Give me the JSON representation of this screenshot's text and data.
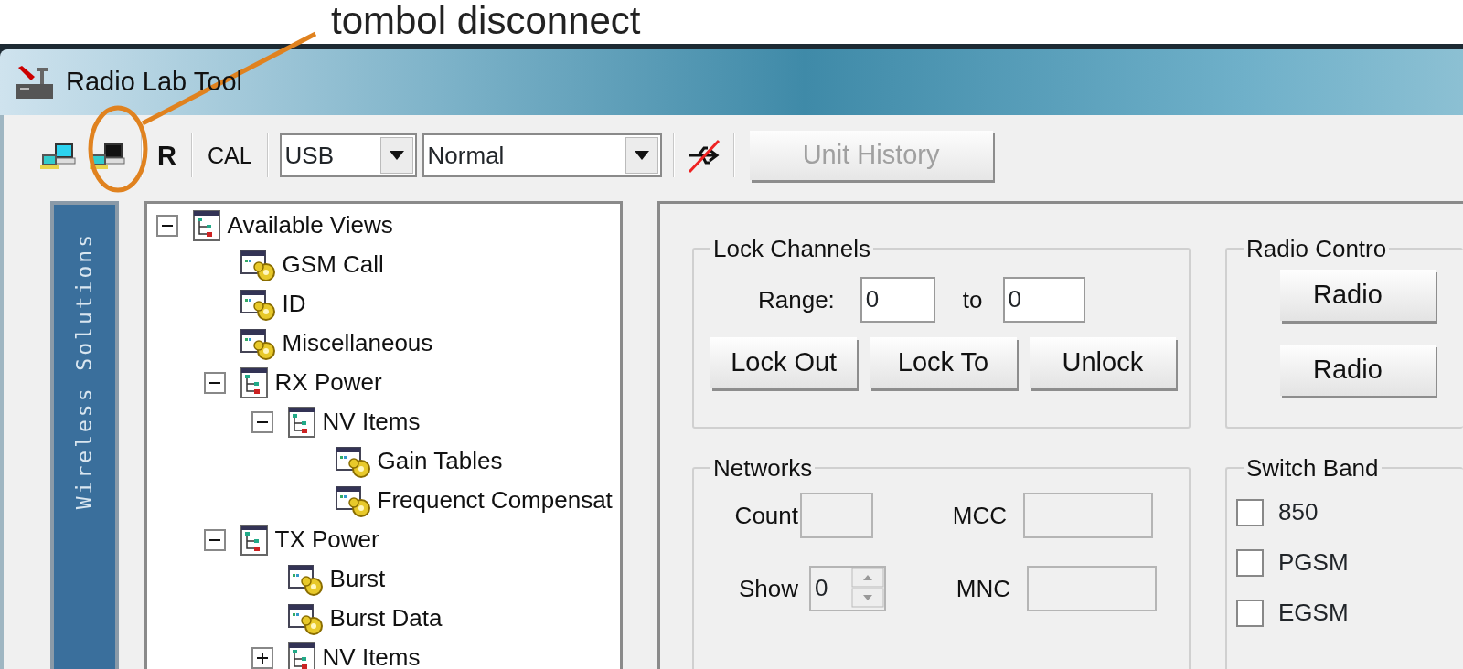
{
  "annotation": {
    "text": "tombol disconnect"
  },
  "window": {
    "title": "Radio Lab Tool"
  },
  "toolbar": {
    "r_button": "R",
    "cal_button": "CAL",
    "port_select": {
      "value": "USB"
    },
    "mode_select": {
      "value": "Normal"
    },
    "unit_history_button": {
      "label": "Unit History",
      "disabled": true
    }
  },
  "sidebar_banner": {
    "text": "Wireless Solutions"
  },
  "tree": [
    {
      "label": "Available Views",
      "kind": "group",
      "expanded": true,
      "children": [
        {
          "label": "GSM Call",
          "kind": "view"
        },
        {
          "label": "ID",
          "kind": "view"
        },
        {
          "label": "Miscellaneous",
          "kind": "view"
        },
        {
          "label": "RX Power",
          "kind": "group",
          "expanded": true,
          "children": [
            {
              "label": "NV Items",
              "kind": "group",
              "expanded": true,
              "children": [
                {
                  "label": "Gain Tables",
                  "kind": "view"
                },
                {
                  "label": "Frequenct Compensat",
                  "kind": "view"
                }
              ]
            }
          ]
        },
        {
          "label": "TX Power",
          "kind": "group",
          "expanded": true,
          "children": [
            {
              "label": "Burst",
              "kind": "view"
            },
            {
              "label": "Burst Data",
              "kind": "view"
            },
            {
              "label": "NV Items",
              "kind": "group",
              "expanded": false
            }
          ]
        }
      ]
    }
  ],
  "lock_channels": {
    "title": "Lock Channels",
    "range_label": "Range:",
    "from_value": "0",
    "to_label": "to",
    "to_value": "0",
    "buttons": [
      "Lock Out",
      "Lock To",
      "Unlock"
    ]
  },
  "radio_control": {
    "title": "Radio Contro",
    "buttons": [
      "Radio",
      "Radio"
    ]
  },
  "networks": {
    "title": "Networks",
    "count_label": "Count",
    "mcc_label": "MCC",
    "show_label": "Show",
    "show_value": "0",
    "mnc_label": "MNC"
  },
  "switch_band": {
    "title": "Switch Band",
    "options": [
      {
        "label": "850",
        "checked": false
      },
      {
        "label": "PGSM",
        "checked": false
      },
      {
        "label": "EGSM",
        "checked": false
      }
    ]
  }
}
